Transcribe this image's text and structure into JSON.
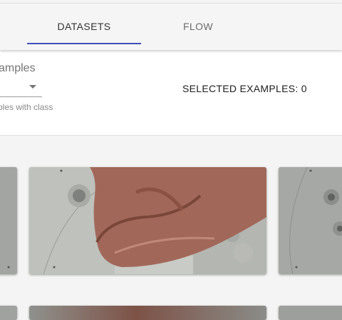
{
  "tabs": [
    {
      "label": "DATASETS",
      "active": true
    },
    {
      "label": "FLOW",
      "active": false
    }
  ],
  "controls": {
    "select_label": "amples",
    "hint": "ples with class",
    "selected_examples": "SELECTED EXAMPLES: 0"
  },
  "colors": {
    "accent": "#3f51b5",
    "tab_background": "#f5f5f5",
    "page_background": "#f4f4f4"
  },
  "icons": {
    "select_arrow": "dropdown-arrow-icon"
  }
}
